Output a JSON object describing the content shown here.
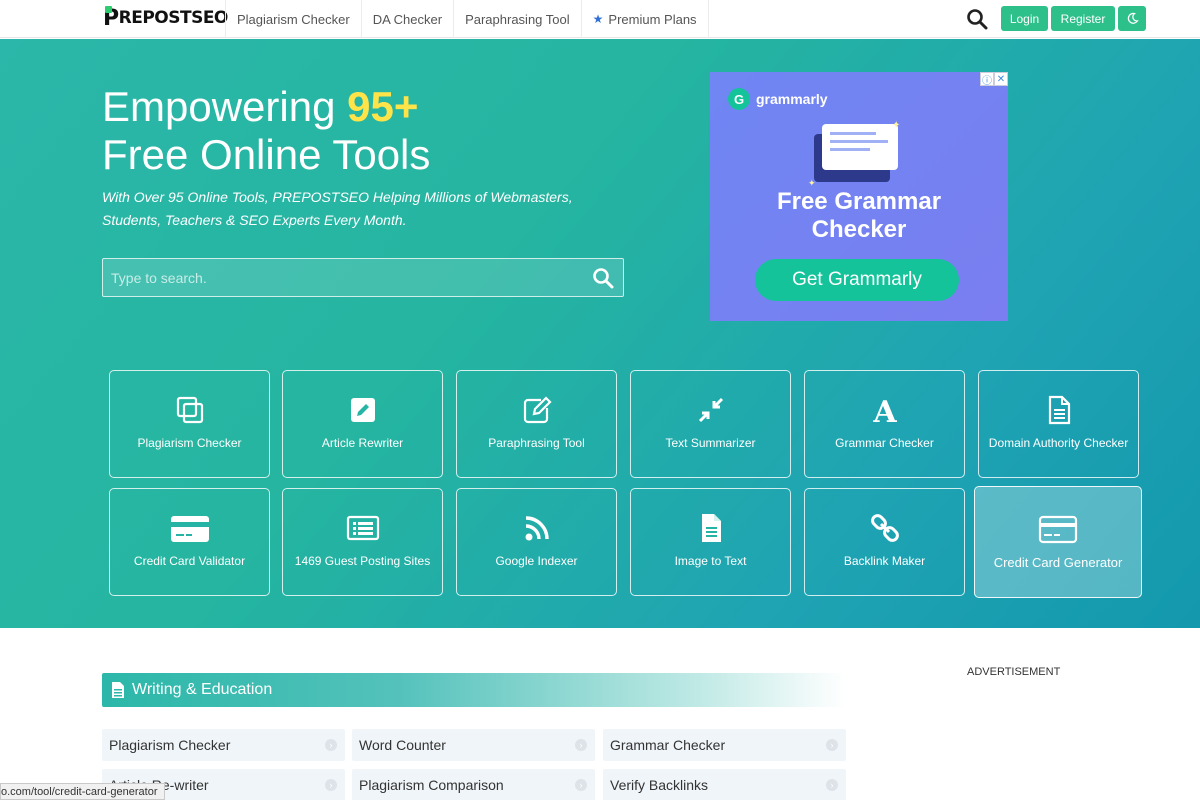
{
  "header": {
    "logo": "REPOSTSEO",
    "logo_initial": "P",
    "nav": [
      "Plagiarism Checker",
      "DA Checker",
      "Paraphrasing Tool"
    ],
    "premium": "Premium Plans",
    "login": "Login",
    "register": "Register"
  },
  "hero": {
    "title_prefix": "Empowering ",
    "title_highlight": "95+",
    "title_line2": "Free Online Tools",
    "subtitle": "With Over 95 Online Tools, PREPOSTSEO Helping Millions of Webmasters, Students, Teachers & SEO Experts Every Month.",
    "search_placeholder": "Type to search."
  },
  "ad": {
    "brand": "grammarly",
    "title": "Free Grammar Checker",
    "cta": "Get Grammarly"
  },
  "tools": [
    {
      "label": "Plagiarism Checker",
      "icon": "copy-icon"
    },
    {
      "label": "Article Rewriter",
      "icon": "edit-icon"
    },
    {
      "label": "Paraphrasing Tool",
      "icon": "pen-square-icon"
    },
    {
      "label": "Text Summarizer",
      "icon": "compress-icon"
    },
    {
      "label": "Grammar Checker",
      "icon": "font-a-icon"
    },
    {
      "label": "Domain Authority Checker",
      "icon": "document-icon"
    },
    {
      "label": "Credit Card Validator",
      "icon": "credit-card-icon"
    },
    {
      "label": "1469 Guest Posting Sites",
      "icon": "list-icon"
    },
    {
      "label": "Google Indexer",
      "icon": "rss-icon"
    },
    {
      "label": "Image to Text",
      "icon": "file-text-icon"
    },
    {
      "label": "Backlink Maker",
      "icon": "link-icon"
    },
    {
      "label": "Credit Card Generator",
      "icon": "credit-card-icon"
    }
  ],
  "section": {
    "title": "Writing & Education",
    "advertisement": "ADVERTISEMENT",
    "links": [
      "Plagiarism Checker",
      "Word Counter",
      "Grammar Checker",
      "Article Re-writer",
      "Plagiarism Comparison",
      "Verify Backlinks"
    ]
  },
  "status_url": "o.com/tool/credit-card-generator"
}
